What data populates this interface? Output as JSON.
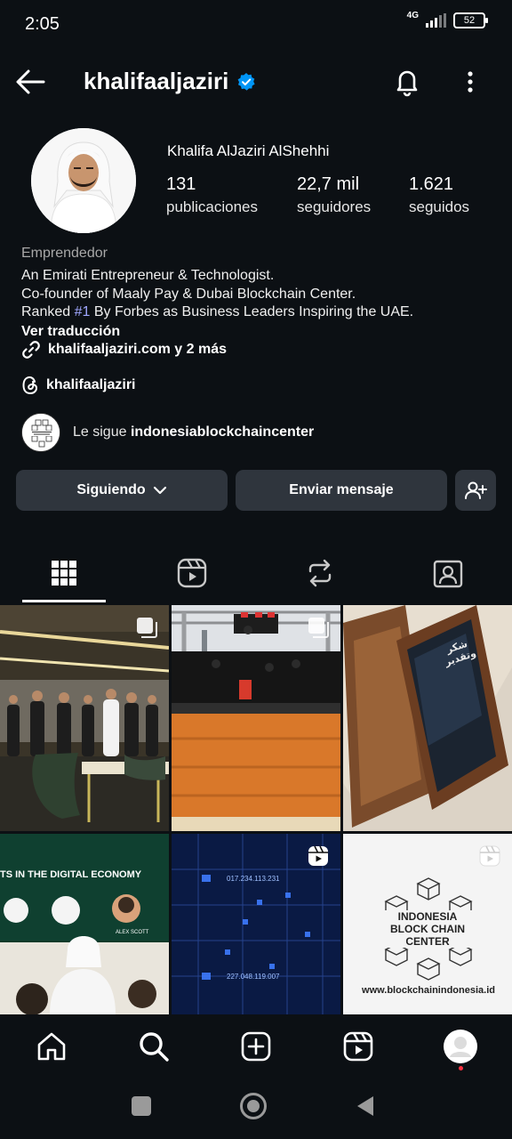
{
  "status_bar": {
    "time": "2:05",
    "network": "4G",
    "battery": "52"
  },
  "header": {
    "username": "khalifaaljaziri",
    "verified": true
  },
  "profile": {
    "full_name": "Khalifa AlJaziri AlShehhi",
    "stats": [
      {
        "value": "131",
        "label": "publicaciones"
      },
      {
        "value": "22,7 mil",
        "label": "seguidores"
      },
      {
        "value": "1.621",
        "label": "seguidos"
      }
    ],
    "category": "Emprendedor",
    "bio": {
      "line1": "An Emirati Entrepreneur & Technologist.",
      "line2": "Co-founder of Maaly Pay & Dubai Blockchain Center.",
      "line3_before": "Ranked ",
      "line3_hash": "#1",
      "line3_after": " By Forbes as Business Leaders Inspiring the UAE."
    },
    "see_translation": "Ver traducción",
    "link": "khalifaaljaziri.com y 2 más",
    "threads_handle": "khalifaaljaziri",
    "followed_by_prefix": "Le sigue ",
    "followed_by_user": "indonesiablockchaincenter"
  },
  "actions": {
    "following_label": "Siguiendo",
    "message_label": "Enviar mensaje"
  },
  "tabs": [
    "grid",
    "reels",
    "reposts",
    "tagged"
  ],
  "posts": [
    {
      "kind": "carousel",
      "text": ""
    },
    {
      "kind": "carousel",
      "text": ""
    },
    {
      "kind": "photo",
      "text": "شكر وتقدير"
    },
    {
      "kind": "photo",
      "text": "TS IN THE DIGITAL ECONOMY"
    },
    {
      "kind": "reel",
      "text": ""
    },
    {
      "kind": "reel",
      "text": "INDONESIA BLOCK CHAIN CENTER",
      "url": "www.blockchainindonesia.id"
    }
  ],
  "grid_texts": {
    "p4_names": [
      "ALEX SCOTT"
    ],
    "p5_ips": [
      "017.234.113.231",
      "227.048.119.007"
    ]
  },
  "colors": {
    "background": "#0c1014",
    "button": "#2f353d",
    "verified": "#0095f6",
    "notification_dot": "#ff3040"
  }
}
